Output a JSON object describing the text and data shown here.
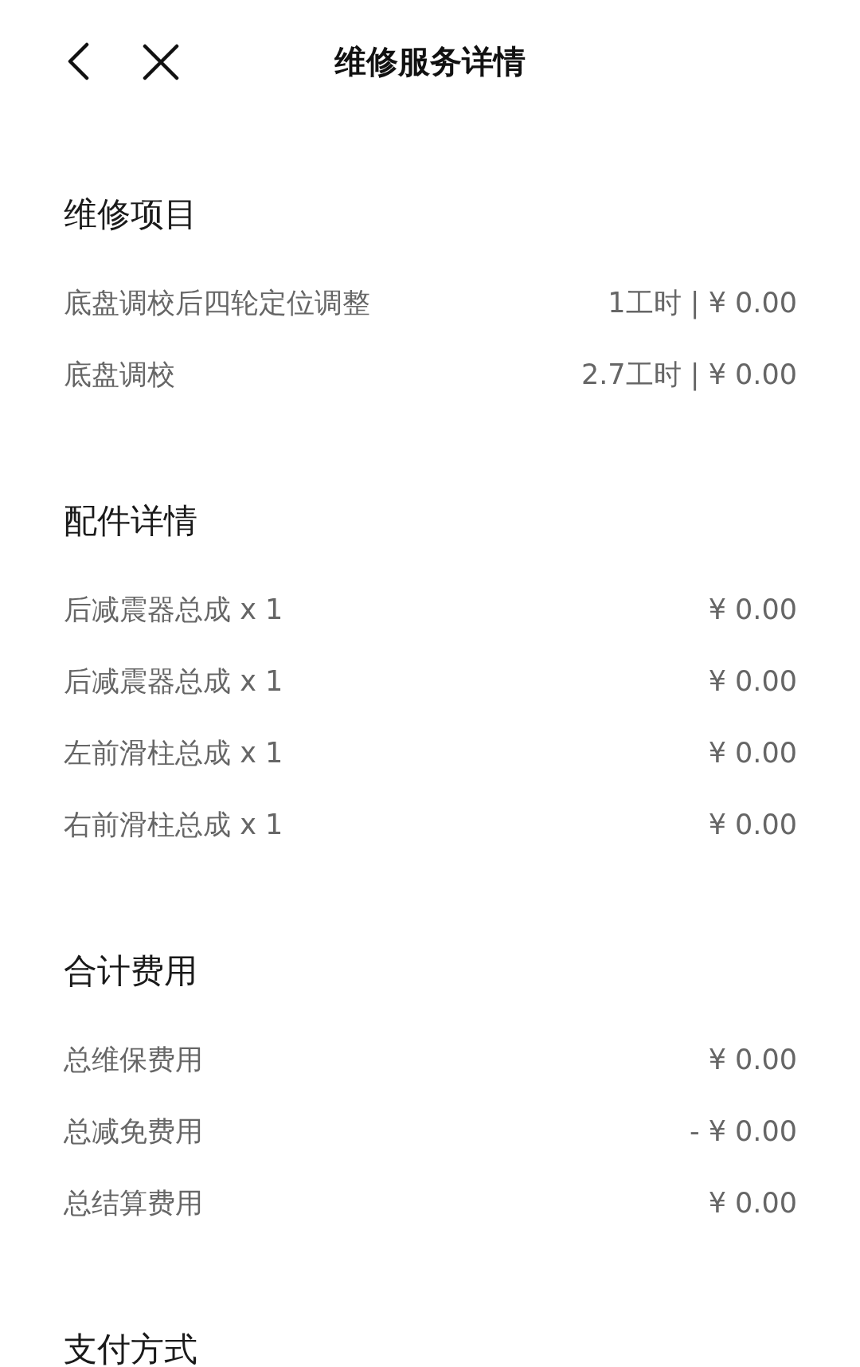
{
  "header": {
    "title": "维修服务详情"
  },
  "sections": [
    {
      "title": "维修项目",
      "rows": [
        {
          "label": "底盘调校后四轮定位调整",
          "value": "1工时 | ¥ 0.00"
        },
        {
          "label": "底盘调校",
          "value": "2.7工时 | ¥ 0.00"
        }
      ]
    },
    {
      "title": "配件详情",
      "rows": [
        {
          "label": "后减震器总成 x 1",
          "value": "¥ 0.00"
        },
        {
          "label": "后减震器总成 x 1",
          "value": "¥ 0.00"
        },
        {
          "label": "左前滑柱总成 x 1",
          "value": "¥ 0.00"
        },
        {
          "label": "右前滑柱总成 x 1",
          "value": "¥ 0.00"
        }
      ]
    },
    {
      "title": "合计费用",
      "rows": [
        {
          "label": "总维保费用",
          "value": "¥ 0.00"
        },
        {
          "label": "总减免费用",
          "value": "- ¥ 0.00"
        },
        {
          "label": "总结算费用",
          "value": "¥ 0.00"
        }
      ]
    },
    {
      "title": "支付方式"
    }
  ]
}
